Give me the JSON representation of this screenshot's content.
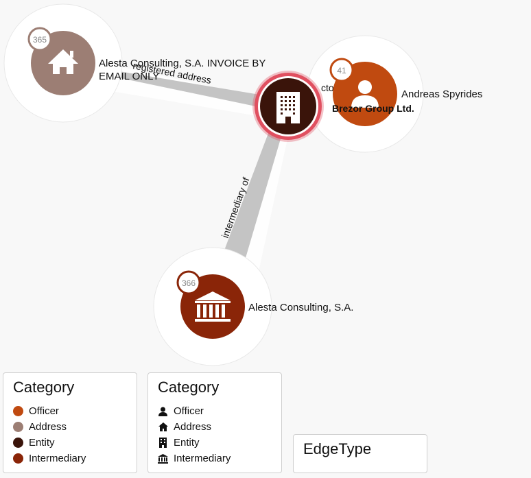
{
  "nodes": {
    "address": {
      "label_line1": "Alesta Consulting, S.A. INVOICE BY",
      "label_line2": "EMAIL ONLY",
      "badge": "365",
      "category": "Address",
      "icon": "house-icon"
    },
    "officer": {
      "label": "Andreas Spyrides",
      "badge": "41",
      "category": "Officer",
      "icon": "person-icon"
    },
    "entity": {
      "label": "Brezor Group Ltd.",
      "category": "Entity",
      "icon": "building-icon"
    },
    "intermediary": {
      "label": "Alesta Consulting, S.A.",
      "badge": "366",
      "category": "Intermediary",
      "icon": "bank-icon"
    }
  },
  "edges": [
    {
      "from": "entity",
      "to": "address",
      "label": "registered address"
    },
    {
      "from": "officer",
      "to": "entity",
      "label": "cto"
    },
    {
      "from": "intermediary",
      "to": "entity",
      "label": "intermediary of"
    }
  ],
  "legend_color": {
    "title": "Category",
    "items": [
      {
        "label": "Officer",
        "color": "#c04a10"
      },
      {
        "label": "Address",
        "color": "#9c7e74"
      },
      {
        "label": "Entity",
        "color": "#3a140a"
      },
      {
        "label": "Intermediary",
        "color": "#8a2508"
      }
    ]
  },
  "legend_icon": {
    "title": "Category",
    "items": [
      {
        "label": "Officer",
        "icon": "person-icon"
      },
      {
        "label": "Address",
        "icon": "house-icon"
      },
      {
        "label": "Entity",
        "icon": "building-icon"
      },
      {
        "label": "Intermediary",
        "icon": "bank-icon"
      }
    ]
  },
  "legend_edge": {
    "title": "EdgeType"
  },
  "colors": {
    "officer": "#c04a10",
    "address": "#9c7e74",
    "entity": "#3a140a",
    "intermediary": "#8a2508",
    "selected_ring": "#e05060",
    "edge": "#c4c4c4"
  }
}
